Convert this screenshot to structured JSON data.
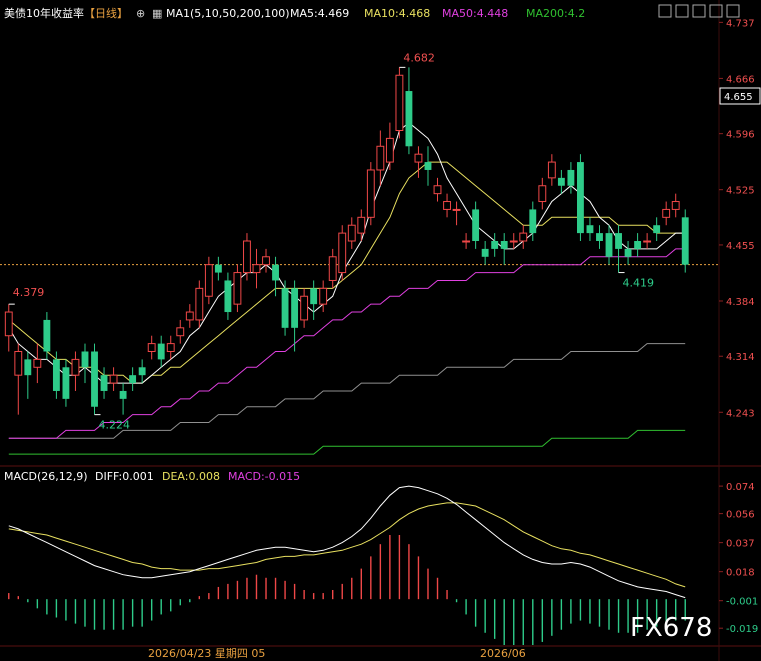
{
  "header": {
    "title": "美债10年收益率",
    "period": "【日线】",
    "ma_label": "MA1(5,10,50,200,100)",
    "ma5": "MA5:4.469",
    "ma10": "MA10:4.468",
    "ma50": "MA50:4.448",
    "ma200": "MA200:4.2"
  },
  "macd_header": {
    "label": "MACD(26,12,9)",
    "diff": "DIFF:0.001",
    "dea": "DEA:0.008",
    "macd": "MACD:-0.015"
  },
  "colors": {
    "up": "#f04848",
    "down": "#2ecc8a",
    "ma5": "#ffffff",
    "ma10": "#e8e060",
    "ma50": "#e040e0",
    "ma200": "#30c030",
    "ma100": "#909090",
    "dea": "#e8e060",
    "diff": "#ffffff",
    "price_line": "#e8a040"
  },
  "icons": [
    "settings-icon",
    "zoom-icon",
    "layout-icon",
    "export-icon",
    "scroll-icon",
    "share-icon",
    "more-icon"
  ],
  "chart_data": [
    {
      "type": "candlestick",
      "ylim": [
        4.18,
        4.74
      ],
      "yticks": [
        "4.737",
        "4.666",
        "4.596",
        "4.525",
        "4.455",
        "4.384",
        "4.314",
        "4.243"
      ],
      "last_price": "4.655",
      "annotations": {
        "high": "4.682",
        "low": "4.224",
        "left_high": "4.379",
        "right_low": "4.419"
      },
      "xlabels": [
        "2026/04/23 星期四 05",
        "2026/06"
      ],
      "candles": [
        [
          4.34,
          4.37,
          4.38,
          4.32
        ],
        [
          4.29,
          4.32,
          4.33,
          4.24
        ],
        [
          4.31,
          4.29,
          4.32,
          4.26
        ],
        [
          4.3,
          4.31,
          4.33,
          4.28
        ],
        [
          4.36,
          4.32,
          4.37,
          4.31
        ],
        [
          4.31,
          4.27,
          4.32,
          4.26
        ],
        [
          4.3,
          4.26,
          4.31,
          4.25
        ],
        [
          4.29,
          4.31,
          4.32,
          4.27
        ],
        [
          4.32,
          4.3,
          4.33,
          4.28
        ],
        [
          4.32,
          4.25,
          4.33,
          4.24
        ],
        [
          4.29,
          4.27,
          4.3,
          4.26
        ],
        [
          4.28,
          4.29,
          4.3,
          4.27
        ],
        [
          4.27,
          4.26,
          4.28,
          4.24
        ],
        [
          4.29,
          4.28,
          4.3,
          4.27
        ],
        [
          4.3,
          4.29,
          4.31,
          4.28
        ],
        [
          4.32,
          4.33,
          4.34,
          4.31
        ],
        [
          4.33,
          4.31,
          4.34,
          4.3
        ],
        [
          4.32,
          4.33,
          4.34,
          4.31
        ],
        [
          4.34,
          4.35,
          4.36,
          4.33
        ],
        [
          4.36,
          4.37,
          4.38,
          4.35
        ],
        [
          4.36,
          4.4,
          4.41,
          4.35
        ],
        [
          4.39,
          4.43,
          4.44,
          4.38
        ],
        [
          4.43,
          4.42,
          4.44,
          4.41
        ],
        [
          4.41,
          4.37,
          4.42,
          4.36
        ],
        [
          4.38,
          4.42,
          4.43,
          4.37
        ],
        [
          4.42,
          4.46,
          4.47,
          4.41
        ],
        [
          4.42,
          4.43,
          4.45,
          4.4
        ],
        [
          4.43,
          4.44,
          4.45,
          4.42
        ],
        [
          4.43,
          4.41,
          4.44,
          4.39
        ],
        [
          4.4,
          4.35,
          4.41,
          4.34
        ],
        [
          4.4,
          4.35,
          4.41,
          4.32
        ],
        [
          4.36,
          4.39,
          4.4,
          4.35
        ],
        [
          4.4,
          4.38,
          4.41,
          4.36
        ],
        [
          4.38,
          4.4,
          4.41,
          4.37
        ],
        [
          4.41,
          4.44,
          4.45,
          4.4
        ],
        [
          4.42,
          4.47,
          4.48,
          4.41
        ],
        [
          4.46,
          4.48,
          4.49,
          4.45
        ],
        [
          4.47,
          4.49,
          4.5,
          4.46
        ],
        [
          4.49,
          4.55,
          4.56,
          4.48
        ],
        [
          4.55,
          4.58,
          4.6,
          4.53
        ],
        [
          4.56,
          4.59,
          4.61,
          4.55
        ],
        [
          4.6,
          4.67,
          4.68,
          4.59
        ],
        [
          4.65,
          4.58,
          4.68,
          4.57
        ],
        [
          4.56,
          4.57,
          4.58,
          4.54
        ],
        [
          4.56,
          4.55,
          4.58,
          4.53
        ],
        [
          4.52,
          4.53,
          4.54,
          4.51
        ],
        [
          4.5,
          4.51,
          4.52,
          4.49
        ],
        [
          4.5,
          4.5,
          4.51,
          4.48
        ],
        [
          4.46,
          4.46,
          4.47,
          4.45
        ],
        [
          4.5,
          4.46,
          4.51,
          4.45
        ],
        [
          4.45,
          4.44,
          4.46,
          4.43
        ],
        [
          4.46,
          4.45,
          4.47,
          4.44
        ],
        [
          4.46,
          4.45,
          4.47,
          4.43
        ],
        [
          4.46,
          4.46,
          4.47,
          4.45
        ],
        [
          4.46,
          4.47,
          4.48,
          4.45
        ],
        [
          4.5,
          4.47,
          4.51,
          4.46
        ],
        [
          4.51,
          4.53,
          4.54,
          4.5
        ],
        [
          4.54,
          4.56,
          4.57,
          4.53
        ],
        [
          4.54,
          4.53,
          4.55,
          4.52
        ],
        [
          4.55,
          4.53,
          4.56,
          4.52
        ],
        [
          4.56,
          4.47,
          4.57,
          4.46
        ],
        [
          4.48,
          4.47,
          4.49,
          4.46
        ],
        [
          4.47,
          4.46,
          4.48,
          4.45
        ],
        [
          4.47,
          4.44,
          4.48,
          4.43
        ],
        [
          4.47,
          4.45,
          4.48,
          4.42
        ],
        [
          4.45,
          4.44,
          4.46,
          4.43
        ],
        [
          4.46,
          4.45,
          4.47,
          4.44
        ],
        [
          4.46,
          4.46,
          4.47,
          4.45
        ],
        [
          4.48,
          4.47,
          4.49,
          4.46
        ],
        [
          4.49,
          4.5,
          4.51,
          4.48
        ],
        [
          4.5,
          4.51,
          4.52,
          4.49
        ],
        [
          4.49,
          4.43,
          4.5,
          4.42
        ]
      ],
      "ma5": [
        4.35,
        4.33,
        4.32,
        4.31,
        4.31,
        4.3,
        4.29,
        4.29,
        4.3,
        4.29,
        4.28,
        4.28,
        4.28,
        4.28,
        4.28,
        4.29,
        4.3,
        4.31,
        4.32,
        4.34,
        4.35,
        4.37,
        4.39,
        4.4,
        4.41,
        4.42,
        4.42,
        4.43,
        4.42,
        4.4,
        4.39,
        4.38,
        4.37,
        4.38,
        4.39,
        4.42,
        4.44,
        4.46,
        4.5,
        4.53,
        4.56,
        4.6,
        4.61,
        4.6,
        4.59,
        4.57,
        4.54,
        4.52,
        4.5,
        4.48,
        4.47,
        4.46,
        4.45,
        4.45,
        4.46,
        4.47,
        4.49,
        4.51,
        4.52,
        4.53,
        4.52,
        4.51,
        4.49,
        4.48,
        4.46,
        4.45,
        4.45,
        4.45,
        4.45,
        4.46,
        4.47,
        4.47
      ],
      "ma10": [
        4.36,
        4.35,
        4.34,
        4.33,
        4.32,
        4.31,
        4.31,
        4.3,
        4.3,
        4.3,
        4.29,
        4.29,
        4.29,
        4.28,
        4.28,
        4.29,
        4.29,
        4.3,
        4.3,
        4.31,
        4.32,
        4.33,
        4.34,
        4.35,
        4.36,
        4.37,
        4.38,
        4.39,
        4.4,
        4.4,
        4.4,
        4.4,
        4.4,
        4.4,
        4.4,
        4.41,
        4.42,
        4.43,
        4.45,
        4.47,
        4.49,
        4.52,
        4.54,
        4.55,
        4.56,
        4.56,
        4.56,
        4.55,
        4.54,
        4.53,
        4.52,
        4.51,
        4.5,
        4.49,
        4.48,
        4.48,
        4.48,
        4.49,
        4.49,
        4.49,
        4.49,
        4.49,
        4.49,
        4.49,
        4.48,
        4.48,
        4.48,
        4.48,
        4.47,
        4.47,
        4.47,
        4.47
      ],
      "ma50": [
        4.21,
        4.21,
        4.21,
        4.21,
        4.21,
        4.21,
        4.22,
        4.22,
        4.22,
        4.22,
        4.23,
        4.23,
        4.23,
        4.24,
        4.24,
        4.24,
        4.25,
        4.25,
        4.26,
        4.26,
        4.27,
        4.27,
        4.28,
        4.28,
        4.29,
        4.3,
        4.3,
        4.31,
        4.32,
        4.32,
        4.33,
        4.34,
        4.34,
        4.35,
        4.36,
        4.36,
        4.37,
        4.37,
        4.38,
        4.38,
        4.39,
        4.39,
        4.4,
        4.4,
        4.4,
        4.41,
        4.41,
        4.41,
        4.41,
        4.42,
        4.42,
        4.42,
        4.42,
        4.42,
        4.43,
        4.43,
        4.43,
        4.43,
        4.43,
        4.43,
        4.43,
        4.44,
        4.44,
        4.44,
        4.44,
        4.44,
        4.44,
        4.44,
        4.44,
        4.44,
        4.45,
        4.45
      ],
      "ma100": [
        4.21,
        4.21,
        4.21,
        4.21,
        4.21,
        4.21,
        4.21,
        4.21,
        4.21,
        4.21,
        4.21,
        4.21,
        4.22,
        4.22,
        4.22,
        4.22,
        4.22,
        4.22,
        4.23,
        4.23,
        4.23,
        4.23,
        4.24,
        4.24,
        4.24,
        4.25,
        4.25,
        4.25,
        4.25,
        4.26,
        4.26,
        4.26,
        4.26,
        4.27,
        4.27,
        4.27,
        4.27,
        4.28,
        4.28,
        4.28,
        4.28,
        4.29,
        4.29,
        4.29,
        4.29,
        4.29,
        4.3,
        4.3,
        4.3,
        4.3,
        4.3,
        4.3,
        4.3,
        4.31,
        4.31,
        4.31,
        4.31,
        4.31,
        4.31,
        4.32,
        4.32,
        4.32,
        4.32,
        4.32,
        4.32,
        4.32,
        4.32,
        4.33,
        4.33,
        4.33,
        4.33,
        4.33
      ],
      "ma200": [
        4.19,
        4.19,
        4.19,
        4.19,
        4.19,
        4.19,
        4.19,
        4.19,
        4.19,
        4.19,
        4.19,
        4.19,
        4.19,
        4.19,
        4.19,
        4.19,
        4.19,
        4.19,
        4.19,
        4.19,
        4.19,
        4.19,
        4.19,
        4.19,
        4.19,
        4.19,
        4.19,
        4.19,
        4.19,
        4.19,
        4.19,
        4.19,
        4.19,
        4.2,
        4.2,
        4.2,
        4.2,
        4.2,
        4.2,
        4.2,
        4.2,
        4.2,
        4.2,
        4.2,
        4.2,
        4.2,
        4.2,
        4.2,
        4.2,
        4.2,
        4.2,
        4.2,
        4.2,
        4.2,
        4.2,
        4.2,
        4.2,
        4.21,
        4.21,
        4.21,
        4.21,
        4.21,
        4.21,
        4.21,
        4.21,
        4.21,
        4.22,
        4.22,
        4.22,
        4.22,
        4.22,
        4.22
      ]
    },
    {
      "type": "macd",
      "ylim": [
        -0.03,
        0.078
      ],
      "yticks": [
        "0.074",
        "0.056",
        "0.037",
        "0.018",
        "-0.001",
        "-0.019"
      ],
      "diff": [
        0.048,
        0.046,
        0.043,
        0.04,
        0.037,
        0.034,
        0.031,
        0.028,
        0.025,
        0.022,
        0.02,
        0.018,
        0.016,
        0.015,
        0.014,
        0.014,
        0.015,
        0.016,
        0.017,
        0.018,
        0.02,
        0.022,
        0.024,
        0.026,
        0.028,
        0.03,
        0.032,
        0.033,
        0.034,
        0.034,
        0.033,
        0.032,
        0.031,
        0.032,
        0.034,
        0.037,
        0.041,
        0.046,
        0.053,
        0.061,
        0.068,
        0.073,
        0.074,
        0.073,
        0.071,
        0.069,
        0.066,
        0.062,
        0.057,
        0.052,
        0.047,
        0.042,
        0.037,
        0.033,
        0.029,
        0.026,
        0.024,
        0.023,
        0.023,
        0.024,
        0.023,
        0.021,
        0.018,
        0.015,
        0.012,
        0.01,
        0.008,
        0.007,
        0.006,
        0.005,
        0.003,
        0.001
      ],
      "dea": [
        0.046,
        0.045,
        0.044,
        0.043,
        0.042,
        0.04,
        0.038,
        0.036,
        0.034,
        0.032,
        0.03,
        0.028,
        0.026,
        0.024,
        0.023,
        0.021,
        0.02,
        0.02,
        0.019,
        0.019,
        0.019,
        0.02,
        0.02,
        0.021,
        0.022,
        0.023,
        0.024,
        0.026,
        0.027,
        0.028,
        0.028,
        0.029,
        0.029,
        0.03,
        0.031,
        0.032,
        0.034,
        0.036,
        0.039,
        0.043,
        0.047,
        0.052,
        0.056,
        0.059,
        0.061,
        0.062,
        0.063,
        0.063,
        0.062,
        0.061,
        0.058,
        0.055,
        0.052,
        0.048,
        0.044,
        0.041,
        0.038,
        0.035,
        0.033,
        0.032,
        0.03,
        0.029,
        0.027,
        0.025,
        0.023,
        0.021,
        0.019,
        0.017,
        0.015,
        0.013,
        0.01,
        0.008
      ]
    }
  ],
  "watermark": "FX678"
}
